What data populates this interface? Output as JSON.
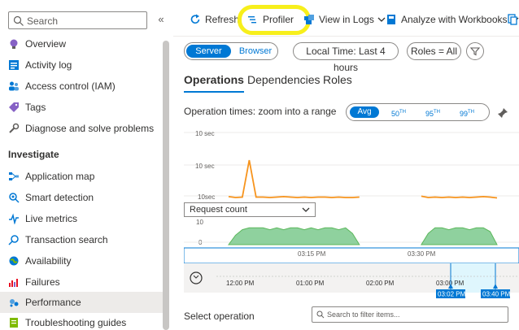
{
  "sidebar": {
    "search_placeholder": "Search",
    "collapse_glyph": "«",
    "items": [
      {
        "label": "Overview",
        "icon": "bulb-icon"
      },
      {
        "label": "Activity log",
        "icon": "activity-log-icon"
      },
      {
        "label": "Access control (IAM)",
        "icon": "people-icon"
      },
      {
        "label": "Tags",
        "icon": "tag-icon"
      },
      {
        "label": "Diagnose and solve problems",
        "icon": "wrench-icon"
      }
    ],
    "section_title": "Investigate",
    "investigate_items": [
      {
        "label": "Application map",
        "icon": "app-map-icon"
      },
      {
        "label": "Smart detection",
        "icon": "smart-detection-icon"
      },
      {
        "label": "Live metrics",
        "icon": "live-metrics-icon"
      },
      {
        "label": "Transaction search",
        "icon": "search-icon"
      },
      {
        "label": "Availability",
        "icon": "globe-icon"
      },
      {
        "label": "Failures",
        "icon": "failures-icon"
      },
      {
        "label": "Performance",
        "icon": "performance-icon",
        "active": true
      },
      {
        "label": "Troubleshooting guides",
        "icon": "guides-icon"
      }
    ]
  },
  "toolbar": {
    "refresh": "Refresh",
    "profiler": "Profiler",
    "view_in_logs": "View in Logs",
    "analyze": "Analyze with Workbooks"
  },
  "filters": {
    "server": "Server",
    "browser": "Browser",
    "local_time": "Local Time: Last 4 hours",
    "roles": "Roles = All"
  },
  "tabs": [
    "Operations",
    "Dependencies",
    "Roles"
  ],
  "operation_times": {
    "title": "Operation times: zoom into a range",
    "percentiles": [
      "Avg",
      "50TH",
      "95TH",
      "99TH"
    ],
    "selected_percentile": "Avg"
  },
  "dropdown": {
    "value": "Request count"
  },
  "select_operation": {
    "label": "Select operation",
    "filter_placeholder": "Search to filter items..."
  },
  "colors": {
    "accent": "#0078d4",
    "duration_line": "#f7941d",
    "count_area": "#5cb85c",
    "highlight": "#f7ef1c"
  },
  "chart_data": [
    {
      "type": "line",
      "title": "",
      "ytick_labels": [
        "10 sec",
        "10 sec",
        "10sec"
      ],
      "x": [
        0,
        1,
        2,
        3,
        4,
        5,
        6,
        7,
        8,
        9,
        10,
        11,
        12,
        13,
        14,
        15,
        16,
        17,
        18,
        19,
        20,
        21,
        22,
        23,
        24,
        25,
        26,
        27,
        28,
        29,
        30,
        31,
        32,
        33,
        34,
        35,
        36,
        37,
        38,
        39
      ],
      "series": [
        {
          "values": [
            1.2,
            1.0,
            1.1,
            9.5,
            1.1,
            1.1,
            1.0,
            1.1,
            1.2,
            1.1,
            1.0,
            1.1,
            1.0,
            1.1,
            1.1,
            1.0,
            1.1,
            1.0,
            1.0,
            1.1,
            null,
            null,
            null,
            null,
            null,
            null,
            null,
            null,
            1.3,
            1.0,
            1.1,
            1.0,
            1.1,
            1.0,
            1.1,
            1.0,
            1.1,
            1.2,
            1.1,
            0.9
          ]
        }
      ]
    },
    {
      "type": "area",
      "ytick_labels": [
        "10",
        "0"
      ],
      "xtick_labels": [
        "03:15 PM",
        "03:30 PM"
      ],
      "series": [
        {
          "values": [
            0,
            5,
            8,
            9,
            9,
            9,
            8,
            9,
            8,
            9,
            9,
            8,
            9,
            8,
            9,
            9,
            8,
            9,
            6,
            0,
            null,
            null,
            null,
            null,
            null,
            null,
            null,
            null,
            0,
            6,
            9,
            9,
            8,
            9,
            9,
            8,
            9,
            9,
            7,
            0
          ]
        }
      ]
    },
    {
      "type": "timeline",
      "xtick_labels": [
        "12:00 PM",
        "01:00 PM",
        "02:00 PM",
        "03:00 PM"
      ],
      "selection_start": "03:02 PM",
      "selection_end": "03:40 PM"
    }
  ]
}
